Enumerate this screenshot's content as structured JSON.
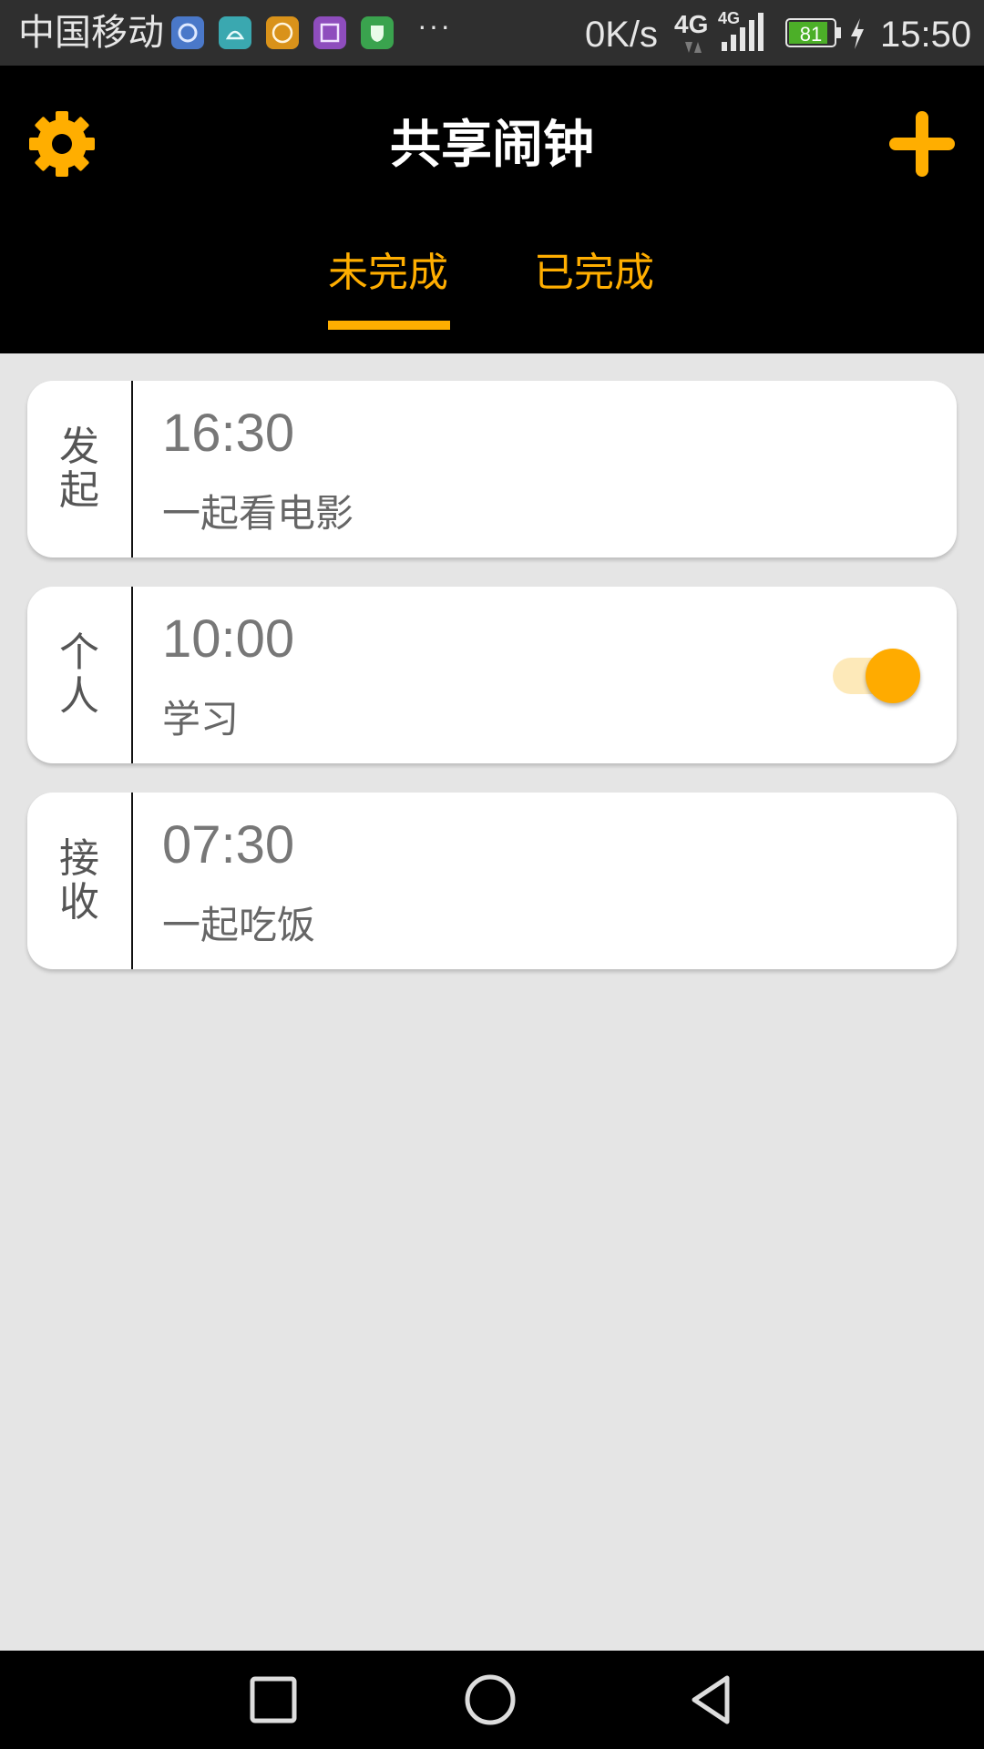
{
  "status_bar": {
    "carrier": "中国移动",
    "more": "···",
    "net_speed": "0K/s",
    "network_type": "4G",
    "signal_type": "4G",
    "battery": "81",
    "time": "15:50",
    "app_icons": [
      "weibo-icon",
      "android-icon",
      "hand-icon",
      "gallery-icon",
      "shield-icon"
    ]
  },
  "header": {
    "title": "共享闹钟",
    "accent_color": "#ffae00"
  },
  "tabs": [
    {
      "label": "未完成",
      "selected": true
    },
    {
      "label": "已完成",
      "selected": false
    }
  ],
  "alarms": [
    {
      "type": "发起",
      "time": "16:30",
      "title": "一起看电影",
      "has_toggle": false
    },
    {
      "type": "个人",
      "time": "10:00",
      "title": "学习",
      "has_toggle": true,
      "toggle_on": true
    },
    {
      "type": "接收",
      "time": "07:30",
      "title": "一起吃饭",
      "has_toggle": false
    }
  ]
}
